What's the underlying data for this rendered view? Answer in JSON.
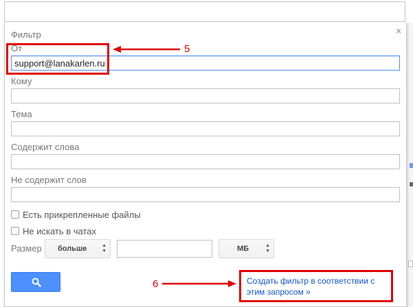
{
  "dialog": {
    "title": "Фильтр",
    "close_glyph": "×"
  },
  "fields": {
    "from": {
      "label": "От",
      "value": "support@lanakarlen.ru"
    },
    "to": {
      "label": "Кому",
      "value": ""
    },
    "subject": {
      "label": "Тема",
      "value": ""
    },
    "has_words": {
      "label": "Содержит слова",
      "value": ""
    },
    "doesnt_have": {
      "label": "Не содержит слов",
      "value": ""
    }
  },
  "checkboxes": {
    "has_attachment": {
      "label": "Есть прикрепленные файлы",
      "checked": false
    },
    "exclude_chats": {
      "label": "Не искать в чатах",
      "checked": false
    }
  },
  "size": {
    "label": "Размер",
    "comparator": "больше",
    "value": "",
    "unit": "МБ"
  },
  "actions": {
    "search_icon": "magnifier-icon",
    "create_filter_label": "Создать фильтр в соответствии с этим запросом »"
  },
  "annotations": {
    "step_5": "5",
    "step_6": "6",
    "color": "#e00000"
  },
  "colors": {
    "accent": "#4d90fe",
    "link": "#1155cc"
  }
}
